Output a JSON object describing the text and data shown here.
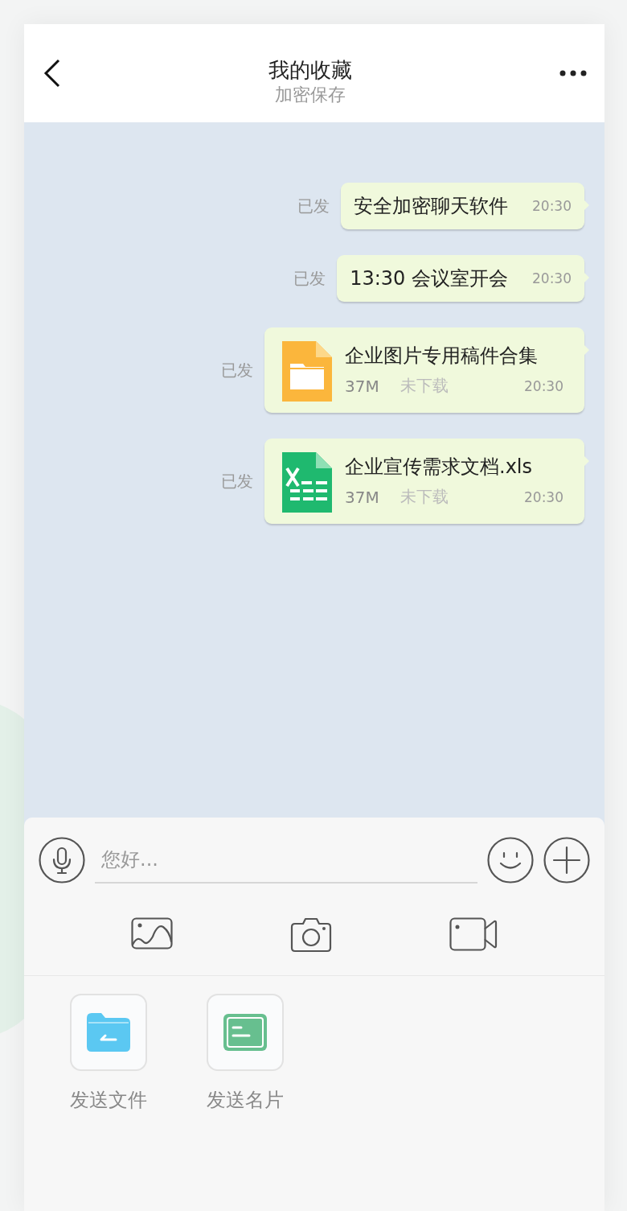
{
  "header": {
    "title": "我的收藏",
    "subtitle": "加密保存"
  },
  "messages": [
    {
      "kind": "text",
      "status": "已发",
      "text": "安全加密聊天软件",
      "time": "20:30"
    },
    {
      "kind": "text",
      "status": "已发",
      "text": "13:30 会议室开会",
      "time": "20:30"
    },
    {
      "kind": "folder_file",
      "status": "已发",
      "name": "企业图片专用稿件合集",
      "size": "37M",
      "download_state": "未下载",
      "time": "20:30"
    },
    {
      "kind": "sheet_file",
      "status": "已发",
      "name": "企业宣传需求文档.xls",
      "size": "37M",
      "download_state": "未下载",
      "time": "20:30"
    }
  ],
  "composer": {
    "placeholder": "您好..."
  },
  "actions": [
    {
      "kind": "folder",
      "label": "发送文件"
    },
    {
      "kind": "card",
      "label": "发送名片"
    }
  ]
}
